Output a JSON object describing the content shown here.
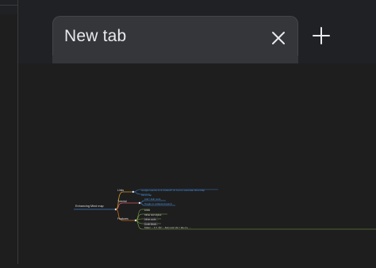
{
  "browser": {
    "tabs": [
      {
        "title": "New tab"
      }
    ],
    "close_icon": "close-icon",
    "new_tab_icon": "plus-icon"
  },
  "mindmap": {
    "root": "Enhancing Mind map",
    "branches": [
      {
        "label": "Links",
        "children": [
          "Google Gemini AI & ChatGPT AI Tool to Generate Mind Map",
          "Mind map"
        ]
      },
      {
        "label": "Tutorial",
        "children": [
          "Add / Edit node",
          "Toggle to collapse/expand"
        ]
      },
      {
        "label": "Features",
        "children": [
          "Links",
          "Inline text styles",
          "Inline code",
          "Code block",
          "Katex: − b ± √(b² − 4ac) over 2a = 2a+ b+ …"
        ]
      }
    ],
    "colors": {
      "background": "#1e1e1e",
      "branch_links": "#d29922",
      "branch_tutorial": "#c85a6a",
      "branch_features": "#c4691e",
      "child_links": "#3a78c2",
      "child_tutorial": "#4a90d9",
      "child_features": "#7da34a",
      "text": "#dcdcdc"
    }
  }
}
